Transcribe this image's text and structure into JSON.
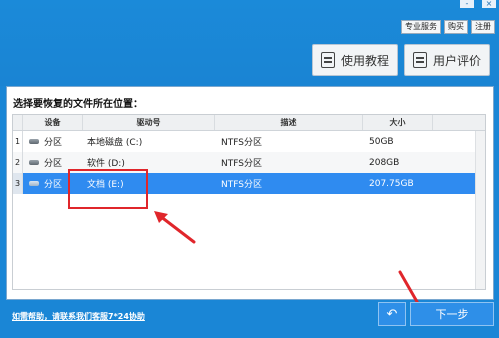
{
  "window": {
    "minimize_glyph": "-",
    "close_glyph": "×"
  },
  "top_links": [
    "专业服务",
    "购买",
    "注册"
  ],
  "header_buttons": {
    "tutorial": {
      "label": "使用教程",
      "icon": "document-icon"
    },
    "review": {
      "label": "用户评价",
      "icon": "comment-icon"
    }
  },
  "prompt": "选择要恢复的文件所在位置：",
  "table": {
    "headers": [
      "设备",
      "驱动号",
      "描述",
      "大小"
    ],
    "rows": [
      {
        "num": "1",
        "device": "分区",
        "drive": "本地磁盘 (C:)",
        "desc": "NTFS分区",
        "size": "50GB",
        "selected": false
      },
      {
        "num": "2",
        "device": "分区",
        "drive": "软件 (D:)",
        "desc": "NTFS分区",
        "size": "208GB",
        "selected": false
      },
      {
        "num": "3",
        "device": "分区",
        "drive": "文档 (E:)",
        "desc": "NTFS分区",
        "size": "207.75GB",
        "selected": true
      }
    ]
  },
  "footer": {
    "help_link": "如需帮助，请联系我们客服7*24协助",
    "back_glyph": "↶",
    "next_label": "下一步"
  },
  "colors": {
    "background": "#1a86d6",
    "selected_row": "#2f8bf0",
    "annotation_red": "#e0262b"
  }
}
